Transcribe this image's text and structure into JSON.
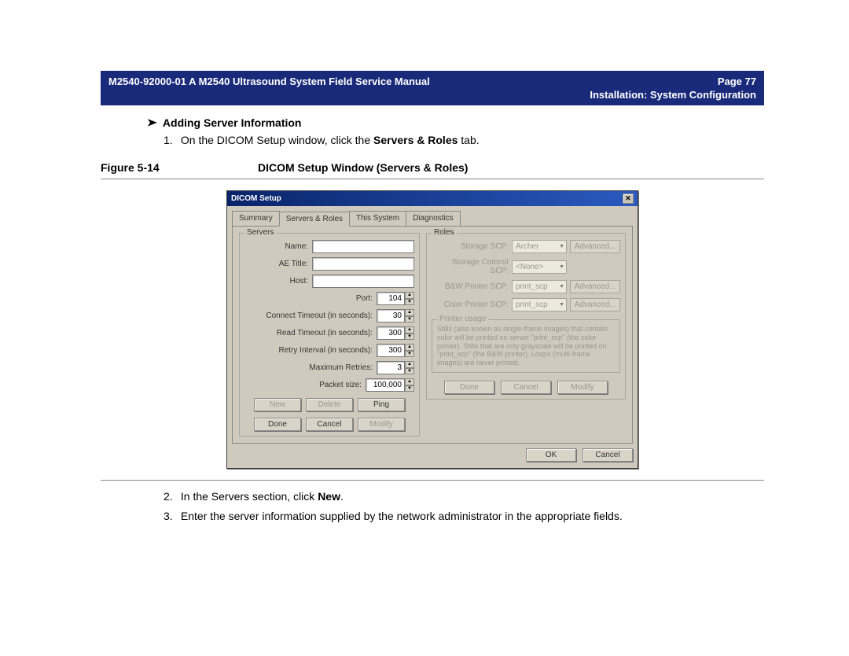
{
  "header": {
    "left": "M2540-92000-01 A M2540 Ultrasound System Field Service Manual",
    "right": "Page 77",
    "sub": "Installation: System Configuration"
  },
  "section_title": "Adding Server Information",
  "step1_prefix": "1.",
  "step1_a": "On the DICOM Setup window, click the ",
  "step1_b": "Servers & Roles",
  "step1_c": " tab.",
  "figure_label": "Figure 5-14",
  "figure_title": "DICOM Setup Window (Servers & Roles)",
  "step2_prefix": "2.",
  "step2_a": "In the Servers section, click ",
  "step2_b": "New",
  "step2_c": ".",
  "step3_prefix": "3.",
  "step3": "Enter the server information supplied by the network administrator in the appropriate fields.",
  "window": {
    "title": "DICOM Setup",
    "close_x": "✕",
    "tabs": {
      "summary": "Summary",
      "servers": "Servers & Roles",
      "thissys": "This System",
      "diag": "Diagnostics"
    },
    "servers": {
      "legend": "Servers",
      "labels": {
        "name": "Name:",
        "ae": "AE Title:",
        "host": "Host:",
        "port": "Port:",
        "connect": "Connect Timeout (in seconds):",
        "read": "Read Timeout (in seconds):",
        "retry": "Retry Interval (in seconds):",
        "maxret": "Maximum Retries:",
        "packet": "Packet size:"
      },
      "values": {
        "name": "",
        "ae": "",
        "host": "",
        "port": "104",
        "connect": "30",
        "read": "300",
        "retry": "300",
        "maxret": "3",
        "packet": "100,000"
      },
      "buttons": {
        "new": "New",
        "delete": "Delete",
        "ping": "Ping",
        "done": "Done",
        "cancel": "Cancel",
        "modify": "Modify"
      }
    },
    "roles": {
      "legend": "Roles",
      "labels": {
        "storage": "Storage SCP:",
        "commit": "Storage Commit SCP:",
        "bw": "B&W Printer SCP:",
        "color": "Color Printer SCP:"
      },
      "values": {
        "storage": "Archer",
        "commit": "<None>",
        "bw": "print_scp",
        "color": "print_scp"
      },
      "adv": "Advanced...",
      "pu_legend": "Printer usage",
      "pu_text": "Stills (also known as single-frame images) that contain color will be printed on server \"print_scp\" (the color printer). Stills that are only grayscale will be printed on \"print_scp\" (the B&W printer). Loops (multi-frame images) are never printed.",
      "buttons": {
        "done": "Done",
        "cancel": "Cancel",
        "modify": "Modify"
      }
    },
    "bottom": {
      "ok": "OK",
      "cancel": "Cancel"
    }
  }
}
